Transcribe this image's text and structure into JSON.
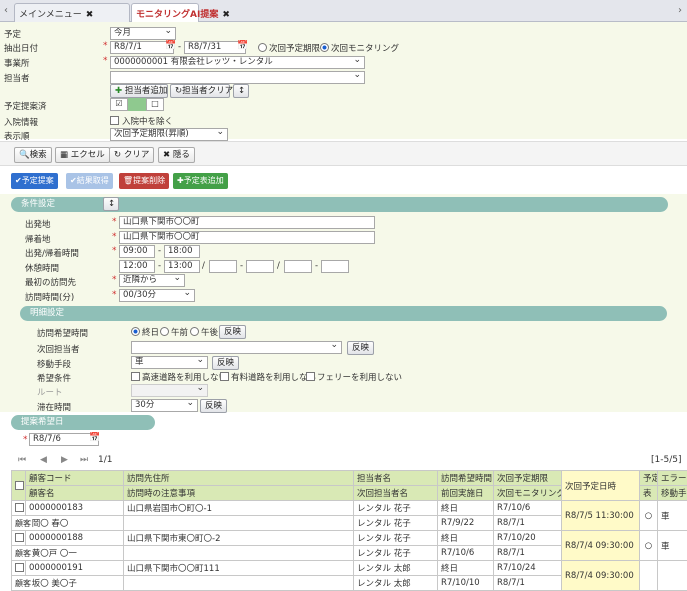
{
  "tabs": [
    {
      "label": "メインメニュー"
    },
    {
      "label": "モニタリングAI提案"
    }
  ],
  "form": {
    "yotei_label": "予定",
    "yotei_value": "今月",
    "date_label": "抽出日付",
    "date_from": "R8/7/1",
    "date_sep": "-",
    "date_to": "R8/7/31",
    "radio_next_deadline": "次回予定期限",
    "radio_next_monitoring": "次回モニタリング",
    "office_label": "事業所",
    "office_value": "0000000001 有限会社レッツ・レンタル",
    "staff_label": "担当者",
    "staff_value": "",
    "add_staff": "担当者追加",
    "clear_staff": "担当者クリア",
    "sort_icon": "↕",
    "proposed_label": "予定提案済",
    "chk_mark": "☑",
    "uncheck_mark": "□",
    "hospital_label": "入院情報",
    "exclude_hospital": "入院中を除く",
    "order_label": "表示順",
    "order_value": "次回予定期限(昇順)"
  },
  "toolbar": {
    "search": "検索",
    "excel": "エクセル",
    "clear": "クリア",
    "hide": "隠る"
  },
  "actions": {
    "propose": "✔予定提案",
    "fetch": "✔結果取得",
    "delete": "提案削除",
    "add": "予定表追加"
  },
  "colors": {
    "propose": "#2f6fcf",
    "fetch": "#a9c3e6",
    "delete": "#c0403a",
    "add": "#43a047"
  },
  "conditions": {
    "title": "条件設定",
    "depart_label": "出発地",
    "depart_value": "山口県下関市〇〇町",
    "return_label": "帰着地",
    "return_value": "山口県下関市〇〇町",
    "time_label": "出発/帰着時間",
    "time_from": "09:00",
    "time_to": "18:00",
    "break_label": "休憩時間",
    "break_from": "12:00",
    "break_to": "13:00",
    "first_label": "最初の訪問先",
    "first_value": "近隣から",
    "visit_label": "訪問時間(分)",
    "visit_value": "00/30分"
  },
  "detail": {
    "title": "明細設定",
    "wish_time_label": "訪問希望時間",
    "opt_all": "終日",
    "opt_am": "午前",
    "opt_pm": "午後",
    "reflect": "反映",
    "next_staff_label": "次回担当者",
    "move_label": "移動手段",
    "move_value": "車",
    "cond_label": "希望条件",
    "cond_highway": "高速道路を利用しない",
    "cond_toll": "有料道路を利用しない",
    "cond_ferry": "フェリーを利用しない",
    "route_label": "ルート",
    "stay_label": "滞在時間",
    "stay_value": "30分"
  },
  "propose_date": {
    "title": "提案希望日",
    "value": "R8/7/6"
  },
  "pager": {
    "first": "⏮",
    "prev": "◀",
    "next": "▶",
    "last": "⏭",
    "page": "1/1",
    "range": "[1-5/5]"
  },
  "table": {
    "h1": {
      "code": "顧客コード",
      "visit": "訪問先住所",
      "staff": "担当者名",
      "wish": "訪問希望時間",
      "next_limit": "次回予定期限",
      "next_date": "次回予定日時",
      "yotei": "予定",
      "error": "エラー"
    },
    "h2": {
      "name": "顧客名",
      "note": "訪問時の注意事項",
      "next_staff": "次回担当者名",
      "last": "前回実施日",
      "next_mon": "次回モニタリング",
      "hyo": "表",
      "move": "移動手"
    },
    "rows": [
      {
        "code": "0000000183",
        "name": "岡〇 春〇",
        "address": "山口県岩国市〇町〇-1",
        "staff": "レンタル 花子",
        "staff2": "レンタル 花子",
        "wish": "終日",
        "last": "R7/9/22",
        "limit": "R7/10/6",
        "mon": "R8/7/1",
        "date": "R8/7/5 11:30:00",
        "yotei": "○",
        "move": "車"
      },
      {
        "code": "0000000188",
        "name": "黄〇戸 〇一",
        "address": "山口県下関市東〇町〇-2",
        "staff": "レンタル 花子",
        "staff2": "レンタル 花子",
        "wish": "終日",
        "last": "R7/10/6",
        "limit": "R7/10/20",
        "mon": "R8/7/1",
        "date": "R8/7/4 09:30:00",
        "yotei": "○",
        "move": "車"
      },
      {
        "code": "0000000191",
        "name": "坂〇 美〇子",
        "address": "山口県下関市〇〇町111",
        "staff": "レンタル 太郎",
        "staff2": "レンタル 太郎",
        "wish": "終日",
        "last": "R7/10/10",
        "limit": "R7/10/24",
        "mon": "R8/7/1",
        "date": "R8/7/4 09:30:00",
        "yotei": "",
        "move": ""
      }
    ],
    "kokyaku_tag": "顧客"
  }
}
